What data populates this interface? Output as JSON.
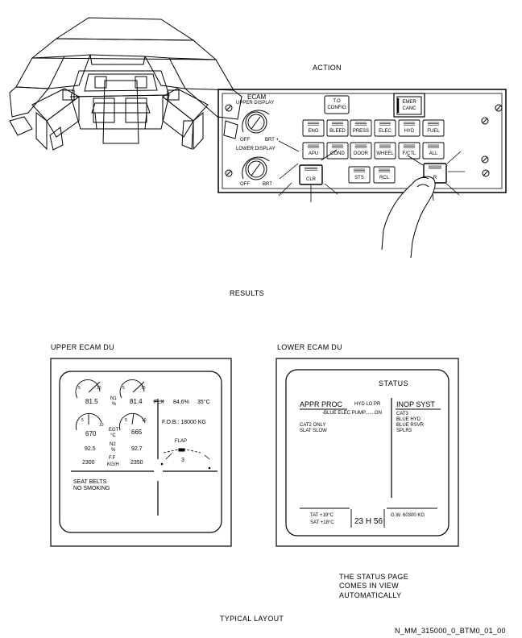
{
  "captions": {
    "action": "ACTION",
    "results": "RESULTS",
    "upper_du": "UPPER ECAM DU",
    "lower_du": "LOWER ECAM DU",
    "status_note": [
      "THE STATUS PAGE",
      "COMES IN VIEW",
      "AUTOMATICALLY"
    ],
    "typical": "TYPICAL LAYOUT",
    "ref": "N_MM_315000_0_BTM0_01_00"
  },
  "control_panel": {
    "title": "ECAM",
    "upper_display": "UPPER DISPLAY",
    "lower_display": "LOWER DISPLAY",
    "off": "OFF",
    "brt_plus": "BRT +",
    "brt": "BRT",
    "to_config": [
      "T.O",
      "CONFIG"
    ],
    "emer_canc": [
      "EMER",
      "CANC"
    ],
    "row1": [
      "ENG",
      "BLEED",
      "PRESS",
      "ELEC",
      "HYD",
      "FUEL"
    ],
    "row2": [
      "APU",
      "COND",
      "DOOR",
      "WHEEL",
      "F/CTL",
      "ALL"
    ],
    "clr": "CLR",
    "sts": "STS",
    "rcl": "RCL",
    "r": "R"
  },
  "upper_ecam": {
    "n1_left": "81.5",
    "n1_right": "81.4",
    "n1_label": "N1",
    "pct": "%",
    "dial_5": "5",
    "dial_10": "10",
    "flx": "FLX",
    "flx_value": "84.6%",
    "flx_temp": "35°C",
    "egt_left": "670",
    "egt_right": "665",
    "egt_label": "EGT",
    "egt_unit": "°C",
    "fob": "F.O.B.:  18000 KG",
    "n2_left": "92.5",
    "n2_right": "92.7",
    "n2_label": "N2",
    "ff_left": "2300",
    "ff_right": "2350",
    "ff_label": "F.F",
    "ff_unit": "KG/H",
    "flap": "FLAP",
    "flap_value": "3",
    "memo": [
      "SEAT BELTS",
      "NO SMOKING"
    ]
  },
  "lower_ecam": {
    "title": "STATUS",
    "appr_proc": "APPR PROC",
    "hyd_lo_pr": "HYD LO PR",
    "blue_elec_pump": "-BLUE ELEC PUMP.......ON",
    "cat2_only": "CAT2 ONLY",
    "slat_slow": "SLAT SLOW",
    "inop_syst": "INOP SYST",
    "inop_items": [
      "CAT3",
      "BLUE HYD",
      "BLUE RSVR",
      "SPLR3"
    ],
    "tat": "TAT  +19°C",
    "sat": "SAT  +18°C",
    "time": "23 H 56",
    "gw": "G.W.  60300 KG"
  }
}
